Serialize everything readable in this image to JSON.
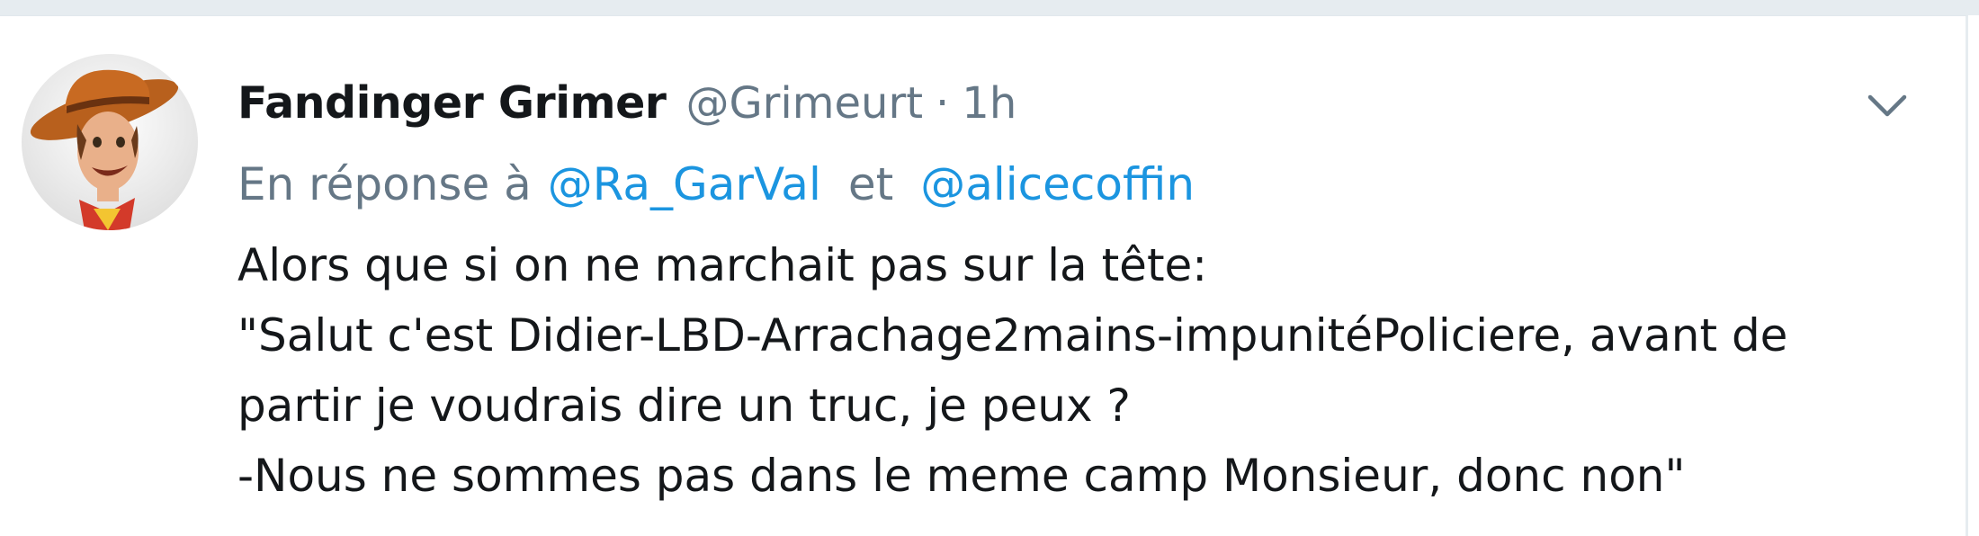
{
  "tweet": {
    "display_name": "Fandinger Grimer",
    "handle": "@Grimeurt",
    "separator": "·",
    "timestamp": "1h",
    "menu_icon": "chevron-down-icon",
    "reply_context": {
      "prefix": "En réponse à",
      "mention_1": "@Ra_GarVal",
      "conjunction": "et",
      "mention_2": "@alicecoffin"
    },
    "text_lines": [
      "Alors que si on ne marchait pas sur la tête:",
      "\"Salut c'est Didier-LBD-Arrachage2mains-impunitéPoliciere, avant de",
      "partir je voudrais dire un truc, je peux ?",
      "-Nous ne sommes pas dans le meme camp Monsieur, donc non\""
    ]
  },
  "colors": {
    "text_primary": "#14171a",
    "text_secondary": "#657786",
    "link": "#1b95e0",
    "background_strip": "#e6ecf0"
  }
}
